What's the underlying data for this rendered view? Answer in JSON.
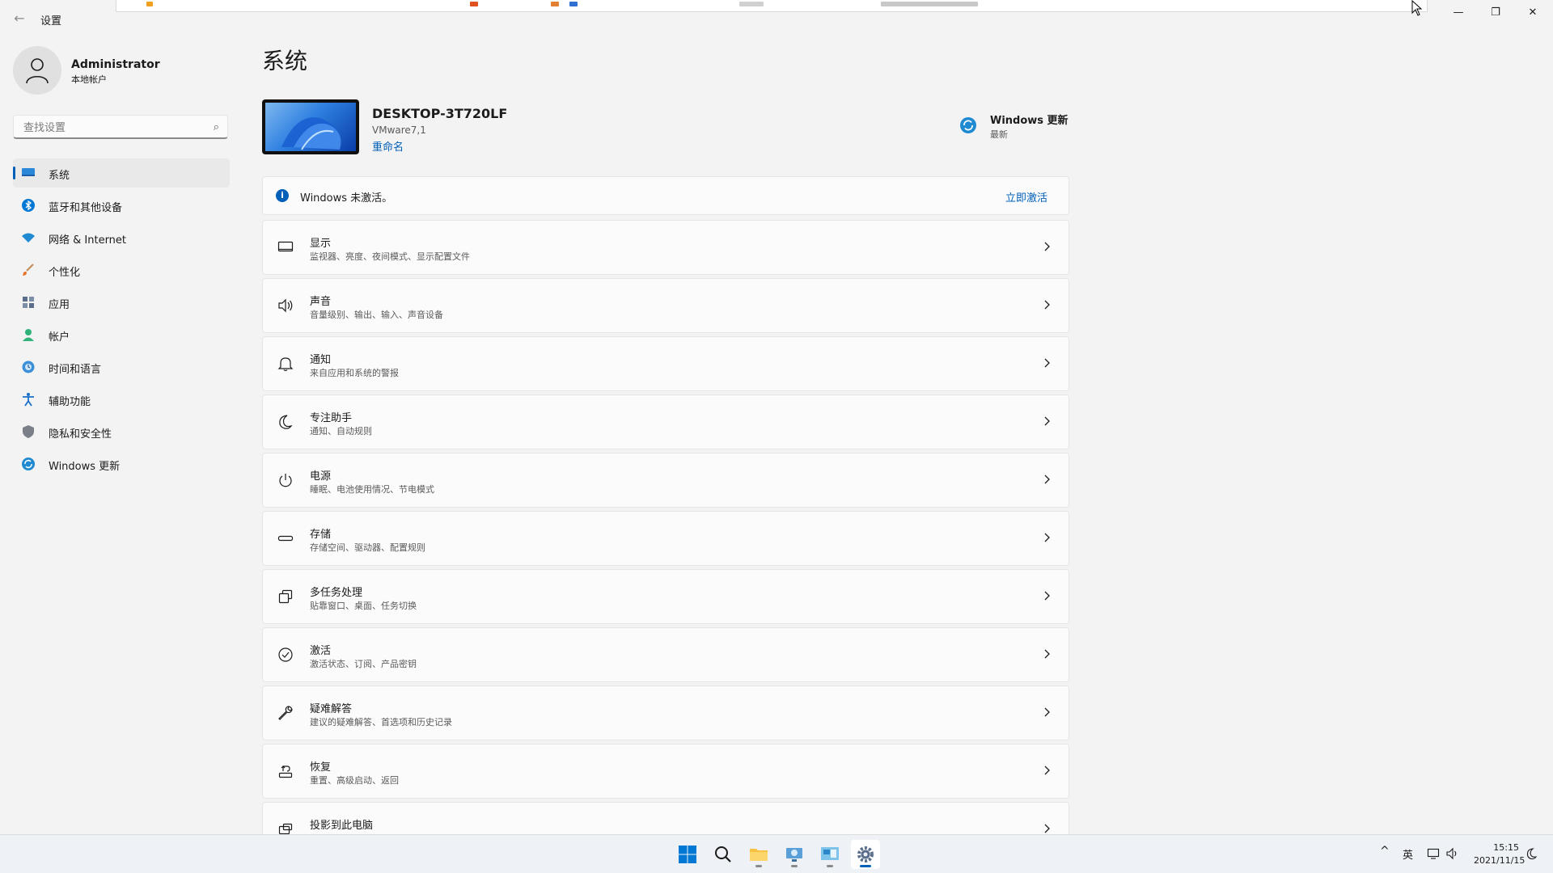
{
  "window": {
    "title": "设置",
    "back_glyph": "←",
    "min_glyph": "—",
    "max_glyph": "❐",
    "close_glyph": "✕"
  },
  "profile": {
    "name": "Administrator",
    "account_type": "本地帐户"
  },
  "search": {
    "placeholder": "查找设置",
    "icon_glyph": "⌕"
  },
  "sidebar": {
    "items": [
      {
        "label": "系统",
        "icon": "system-icon",
        "active": true
      },
      {
        "label": "蓝牙和其他设备",
        "icon": "bluetooth-icon"
      },
      {
        "label": "网络 & Internet",
        "icon": "wifi-icon"
      },
      {
        "label": "个性化",
        "icon": "brush-icon"
      },
      {
        "label": "应用",
        "icon": "apps-icon"
      },
      {
        "label": "帐户",
        "icon": "account-icon"
      },
      {
        "label": "时间和语言",
        "icon": "globe-clock-icon"
      },
      {
        "label": "辅助功能",
        "icon": "accessibility-icon"
      },
      {
        "label": "隐私和安全性",
        "icon": "shield-icon"
      },
      {
        "label": "Windows 更新",
        "icon": "windows-update-icon"
      }
    ]
  },
  "main": {
    "title": "系统",
    "device": {
      "name": "DESKTOP-3T720LF",
      "model": "VMware7,1",
      "rename_label": "重命名"
    },
    "windows_update": {
      "title": "Windows 更新",
      "status": "最新"
    },
    "banner": {
      "text": "Windows 未激活。",
      "action": "立即激活",
      "icon_glyph": "i"
    },
    "settings": [
      {
        "title": "显示",
        "subtitle": "监视器、亮度、夜间模式、显示配置文件",
        "icon": "display-icon"
      },
      {
        "title": "声音",
        "subtitle": "音量级别、输出、输入、声音设备",
        "icon": "speaker-icon"
      },
      {
        "title": "通知",
        "subtitle": "来自应用和系统的警报",
        "icon": "bell-icon"
      },
      {
        "title": "专注助手",
        "subtitle": "通知、自动规则",
        "icon": "moon-icon"
      },
      {
        "title": "电源",
        "subtitle": "睡眠、电池使用情况、节电模式",
        "icon": "power-icon"
      },
      {
        "title": "存储",
        "subtitle": "存储空间、驱动器、配置规则",
        "icon": "storage-icon"
      },
      {
        "title": "多任务处理",
        "subtitle": "贴靠窗口、桌面、任务切换",
        "icon": "multitasking-icon"
      },
      {
        "title": "激活",
        "subtitle": "激活状态、订阅、产品密钥",
        "icon": "check-circle-icon"
      },
      {
        "title": "疑难解答",
        "subtitle": "建议的疑难解答、首选项和历史记录",
        "icon": "wrench-icon"
      },
      {
        "title": "恢复",
        "subtitle": "重置、高级启动、返回",
        "icon": "recovery-icon"
      },
      {
        "title": "投影到此电脑",
        "subtitle": "",
        "icon": "project-icon"
      }
    ]
  },
  "taskbar": {
    "apps": [
      {
        "name": "start-button",
        "icon": "windows-logo-icon"
      },
      {
        "name": "search-button",
        "icon": "search-icon"
      },
      {
        "name": "file-explorer-button",
        "icon": "folder-icon"
      },
      {
        "name": "network-app-button",
        "icon": "network-app-icon"
      },
      {
        "name": "control-panel-button",
        "icon": "control-panel-icon"
      },
      {
        "name": "settings-button",
        "icon": "gear-icon",
        "active": true
      }
    ],
    "tray": {
      "chevron_glyph": "^",
      "ime": "英",
      "time": "15:15",
      "date": "2021/11/15"
    }
  },
  "colors": {
    "accent": "#005fb8",
    "background": "#f3f3f3",
    "card": "#fbfbfb"
  }
}
